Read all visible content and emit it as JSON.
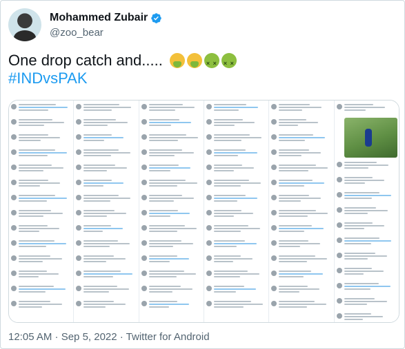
{
  "tweet": {
    "author": {
      "display_name": "Mohammed Zubair",
      "handle": "@zoo_bear",
      "verified": true,
      "avatar_icon": "user-avatar"
    },
    "text_main": "One drop catch and.....",
    "emojis": [
      "face-vomiting-icon",
      "face-vomiting-icon",
      "nauseated-face-icon",
      "nauseated-face-icon"
    ],
    "hashtag": "#INDvsPAK",
    "media": {
      "type": "image",
      "description_icon": "screenshot-collage-of-replies"
    },
    "timestamp": "12:05 AM · Sep 5, 2022 · Twitter for Android"
  },
  "colors": {
    "text": "#0f1419",
    "secondary": "#536471",
    "accent": "#1d9bf0",
    "border": "#cfd9de"
  }
}
